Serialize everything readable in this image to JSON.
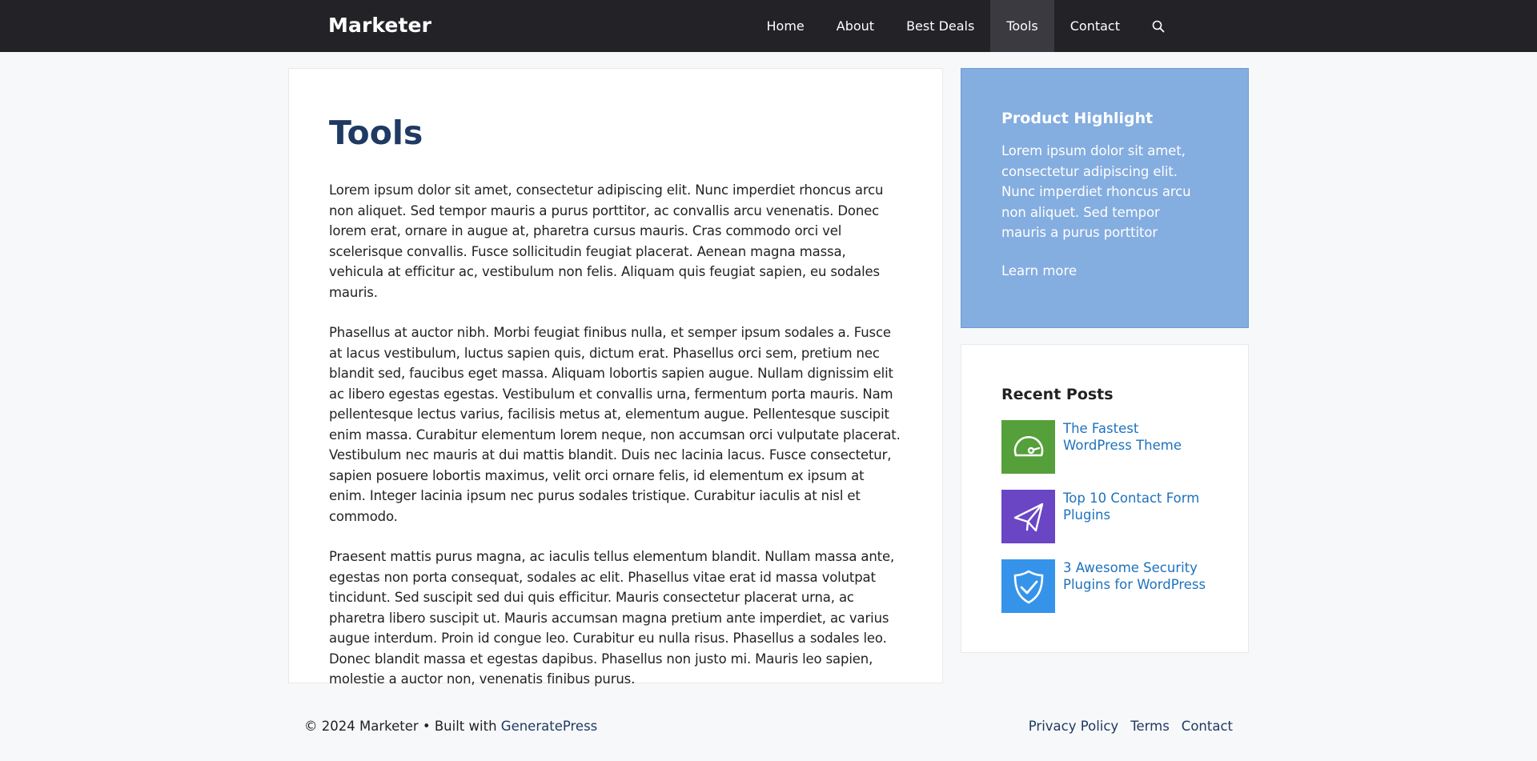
{
  "header": {
    "brand": "Marketer",
    "nav": [
      "Home",
      "About",
      "Best Deals",
      "Tools",
      "Contact"
    ],
    "active_nav": "Tools",
    "search_icon": "search-icon"
  },
  "main": {
    "title": "Tools",
    "paragraphs": [
      "Lorem ipsum dolor sit amet, consectetur adipiscing elit. Nunc imperdiet rhoncus arcu non aliquet. Sed tempor mauris a purus porttitor, ac convallis arcu venenatis. Donec lorem erat, ornare in augue at, pharetra cursus mauris. Cras commodo orci vel scelerisque convallis. Fusce sollicitudin feugiat placerat. Aenean magna massa, vehicula at efficitur ac, vestibulum non felis. Aliquam quis feugiat sapien, eu sodales mauris.",
      "Phasellus at auctor nibh. Morbi feugiat finibus nulla, et semper ipsum sodales a. Fusce at lacus vestibulum, luctus sapien quis, dictum erat. Phasellus orci sem, pretium nec blandit sed, faucibus eget massa. Aliquam lobortis sapien augue. Nullam dignissim elit ac libero egestas egestas. Vestibulum et convallis urna, fermentum porta mauris. Nam pellentesque lectus varius, facilisis metus at, elementum augue. Pellentesque suscipit enim massa. Curabitur elementum lorem neque, non accumsan orci vulputate placerat. Vestibulum nec mauris at dui mattis blandit. Duis nec lacinia lacus. Fusce consectetur, sapien posuere lobortis maximus, velit orci ornare felis, id elementum ex ipsum at enim. Integer lacinia ipsum nec purus sodales tristique. Curabitur iaculis at nisl et commodo.",
      "Praesent mattis purus magna, ac iaculis tellus elementum blandit. Nullam massa ante, egestas non porta consequat, sodales ac elit. Phasellus vitae erat id massa volutpat tincidunt. Sed suscipit sed dui quis efficitur. Mauris consectetur placerat urna, ac pharetra libero suscipit ut. Mauris accumsan magna pretium ante imperdiet, ac varius augue interdum. Proin id congue leo. Curabitur eu nulla risus. Phasellus a sodales leo. Donec blandit massa et egestas dapibus. Phasellus non justo mi. Mauris leo sapien, molestie a auctor non, venenatis finibus purus."
    ]
  },
  "sidebar": {
    "highlight": {
      "title": "Product Highlight",
      "text": "Lorem ipsum dolor sit amet, consectetur adipiscing elit. Nunc imperdiet rhoncus arcu non aliquet. Sed tempor mauris a purus porttitor",
      "link": "Learn more",
      "background": "#84ade0"
    },
    "recent": {
      "title": "Recent Posts",
      "posts": [
        {
          "title": "The Fastest WordPress Theme",
          "icon": "speedometer-icon",
          "color": "#55a03a"
        },
        {
          "title": "Top 10 Contact Form Plugins",
          "icon": "paper-plane-icon",
          "color": "#6a45c4"
        },
        {
          "title": "3 Awesome Security Plugins for WordPress",
          "icon": "shield-check-icon",
          "color": "#3594ea"
        }
      ]
    }
  },
  "footer": {
    "copyright": "© 2024 Marketer • Built with ",
    "built_with_link": "GeneratePress",
    "links": [
      "Privacy Policy",
      "Terms",
      "Contact"
    ]
  },
  "colors": {
    "header_bg": "#222227",
    "title": "#1f3a63",
    "link": "#1e72bd"
  }
}
